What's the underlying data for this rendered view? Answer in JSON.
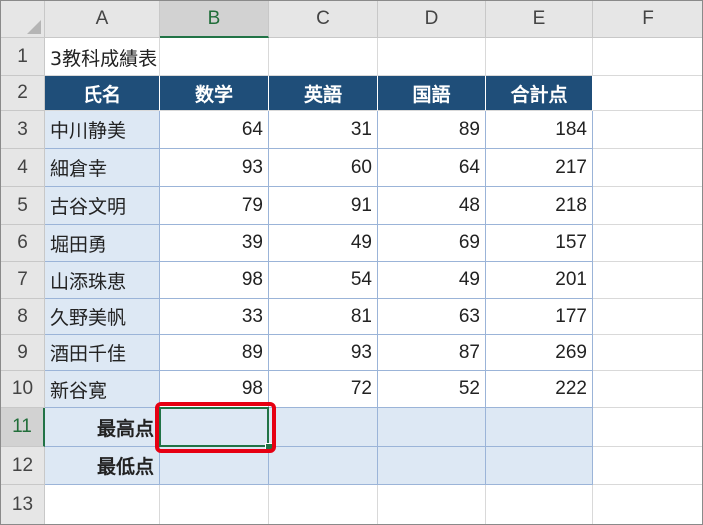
{
  "columns": [
    "A",
    "B",
    "C",
    "D",
    "E",
    "F"
  ],
  "rows": [
    "1",
    "2",
    "3",
    "4",
    "5",
    "6",
    "7",
    "8",
    "9",
    "10",
    "11",
    "12",
    "13"
  ],
  "sheet": {
    "title": "3教科成績表",
    "headers": [
      "氏名",
      "数学",
      "英語",
      "国語",
      "合計点"
    ],
    "students": [
      {
        "name": "中川静美",
        "math": "64",
        "english": "31",
        "japanese": "89",
        "total": "184"
      },
      {
        "name": "細倉幸",
        "math": "93",
        "english": "60",
        "japanese": "64",
        "total": "217"
      },
      {
        "name": "古谷文明",
        "math": "79",
        "english": "91",
        "japanese": "48",
        "total": "218"
      },
      {
        "name": "堀田勇",
        "math": "39",
        "english": "49",
        "japanese": "69",
        "total": "157"
      },
      {
        "name": "山添珠恵",
        "math": "98",
        "english": "54",
        "japanese": "49",
        "total": "201"
      },
      {
        "name": "久野美帆",
        "math": "33",
        "english": "81",
        "japanese": "63",
        "total": "177"
      },
      {
        "name": "酒田千佳",
        "math": "89",
        "english": "93",
        "japanese": "87",
        "total": "269"
      },
      {
        "name": "新谷寛",
        "math": "98",
        "english": "72",
        "japanese": "52",
        "total": "222"
      }
    ],
    "max_label": "最高点",
    "min_label": "最低点"
  },
  "selection": {
    "active_cell": "B11"
  },
  "colors": {
    "header_fill": "#1f4e79",
    "light_fill": "#dde8f4",
    "selection": "#217346",
    "highlight": "#e60012"
  }
}
